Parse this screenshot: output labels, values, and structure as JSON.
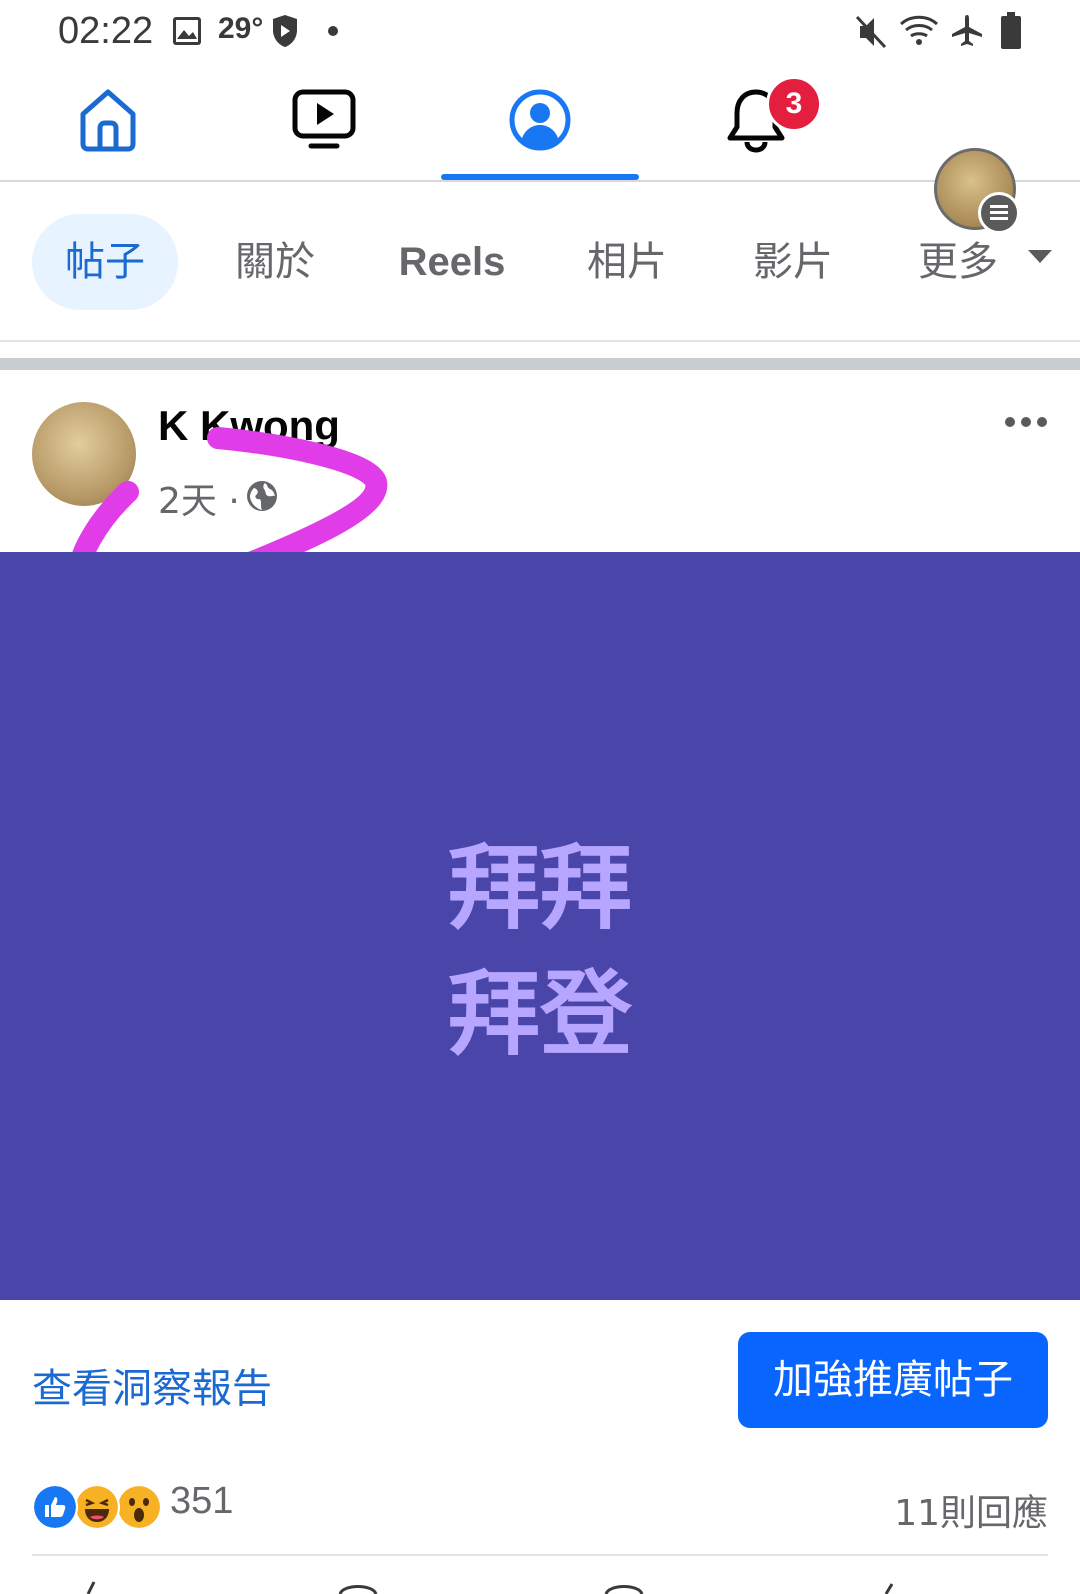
{
  "status_bar": {
    "time": "02:22",
    "temperature": "29°",
    "icons": [
      "gallery-icon",
      "shield-icon",
      "dot-icon",
      "mute-icon",
      "wifi-icon",
      "airplane-icon",
      "battery-icon"
    ]
  },
  "nav": {
    "items": [
      "home-icon",
      "watch-icon",
      "profile-icon",
      "notifications-icon",
      "menu-avatar"
    ],
    "active": "profile-icon",
    "notification_count": "3",
    "accent_color": "#1877f2"
  },
  "tabs": {
    "items": [
      "帖子",
      "關於",
      "Reels",
      "相片",
      "影片",
      "更多"
    ],
    "active": "帖子"
  },
  "post": {
    "author": "K Kwong",
    "time": "2天",
    "separator": "·",
    "image_lines": [
      "拜拜",
      "拜登"
    ],
    "image_bg": "#4a45a8",
    "insights_label": "查看洞察報告",
    "boost_label": "加強推廣帖子",
    "reaction_count": "351",
    "comments_label": "11則回應"
  }
}
